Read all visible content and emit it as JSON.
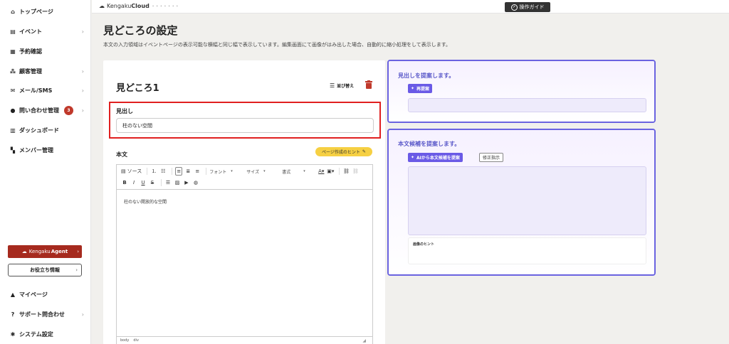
{
  "sidebar": {
    "items": [
      {
        "icon": "home-icon",
        "glyph": "⌂",
        "label": "トップページ",
        "chevron": false
      },
      {
        "icon": "document-icon",
        "glyph": "▤",
        "label": "イベント",
        "chevron": true
      },
      {
        "icon": "calendar-icon",
        "glyph": "▦",
        "label": "予約確認",
        "chevron": false
      },
      {
        "icon": "customers-icon",
        "glyph": "⁂",
        "label": "顧客管理",
        "chevron": true
      },
      {
        "icon": "mail-icon",
        "glyph": "✉",
        "label": "メール/SMS",
        "chevron": true
      },
      {
        "icon": "chat-icon",
        "glyph": "●",
        "label": "問い合わせ管理",
        "chevron": true,
        "badge": "3"
      },
      {
        "icon": "dashboard-icon",
        "glyph": "▥",
        "label": "ダッシュボード",
        "chevron": false
      },
      {
        "icon": "members-icon",
        "glyph": "▚",
        "label": "メンバー管理",
        "chevron": false
      }
    ],
    "bottom_items": [
      {
        "icon": "user-icon",
        "glyph": "▲",
        "label": "マイページ",
        "chevron": false
      },
      {
        "icon": "help-icon",
        "glyph": "?",
        "label": "サポート問合わせ",
        "chevron": true
      },
      {
        "icon": "settings-icon",
        "glyph": "✱",
        "label": "システム設定",
        "chevron": false
      }
    ],
    "agent_button": {
      "prefix": "Kengaku",
      "suffix": "Agent"
    },
    "info_button": "お役立ち情報"
  },
  "topbar": {
    "logo_prefix": "Kengaku",
    "logo_suffix": "Cloud",
    "logo_sub": "• • • • • • •",
    "guide_button": "操作ガイド"
  },
  "page": {
    "title": "見どころの設定",
    "description": "本文の入力領域はイベントページの表示可能な横幅と同じ幅で表示しています。編集画面にて画像がはみ出した場合、自動的に縮小処理をして表示します。"
  },
  "editor_card": {
    "title": "見どころ1",
    "sort_label": "並び替え",
    "heading_label": "見出し",
    "heading_value": "柱のない空間",
    "body_label": "本文",
    "hint_button": "ページ作成のヒント",
    "toolbar": {
      "source": "ソース",
      "font": "フォント",
      "size": "サイズ",
      "format": "書式"
    },
    "body_text": "柱のない開放的な空間",
    "footer_path": [
      "body",
      "div"
    ]
  },
  "ai_heading_panel": {
    "title": "見出しを提案します。",
    "button": "再提案"
  },
  "ai_body_panel": {
    "title": "本文候補を提案します。",
    "button": "AIから本文候補を提案",
    "fix_button": "修正指示",
    "image_hint": "画像のヒント"
  },
  "colors": {
    "accent_purple": "#6a5ae6",
    "highlight_red": "#e02020",
    "agent_red": "#a62a1e",
    "hint_yellow": "#f6d043"
  }
}
